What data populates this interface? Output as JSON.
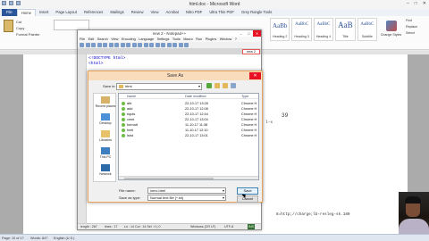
{
  "word": {
    "title": "html.doc - Microsoft Word",
    "window_controls": [
      "–",
      "□",
      "✕"
    ],
    "ribbon_tabs": [
      "File",
      "Home",
      "Insert",
      "Page Layout",
      "References",
      "Mailings",
      "Review",
      "View",
      "Acrobat",
      "Nitro PDF",
      "Ultra Thin PDF",
      "Grey Rangle Tools"
    ],
    "active_tab": "Home",
    "clipboard": {
      "cut": "Cut",
      "copy": "Copy",
      "format_painter": "Format Painter"
    },
    "styles": [
      {
        "preview": "AaBb",
        "name": "Heading 2"
      },
      {
        "preview": "AaBbC",
        "name": "Heading 3"
      },
      {
        "preview": "AaBbC",
        "name": "Heading 4"
      },
      {
        "preview": "AaB",
        "name": "Title"
      },
      {
        "preview": "AaBbC",
        "name": "Subtitle"
      }
    ],
    "change_styles": "Change Styles",
    "editing": [
      "Find",
      "Replace",
      "Select"
    ],
    "doc_fragments": [
      "39",
      "l-s",
      "8=http;//charge;lb-resleg-sk.180"
    ],
    "status": {
      "page": "Page: 10 of 17",
      "words": "Words: 847",
      "language": "English (U.S.)"
    }
  },
  "notepad": {
    "title": "new 2 - Notepad++",
    "menu": [
      "File",
      "Edit",
      "Search",
      "View",
      "Encoding",
      "Language",
      "Settings",
      "Tools",
      "Macro",
      "Run",
      "Plugins",
      "Window",
      "?"
    ],
    "tab": "new 2",
    "code": [
      "<!DOCTYPE html>",
      "<html>"
    ],
    "status": {
      "length": "length : 267",
      "lines": "lines : 17",
      "position": "Ln : 14  Col : 14  Sel : 0 | 0",
      "eol": "Windows (CR LF)",
      "encoding": "UTF-8",
      "mode": "INS"
    }
  },
  "dialog": {
    "title": "Save As",
    "close": "✕",
    "save_in_label": "Save in:",
    "save_in_value": "html",
    "places": [
      "Recent places",
      "Desktop",
      "Libraries",
      "This PC",
      "Network"
    ],
    "columns": [
      "Name",
      "Date modified",
      "Type"
    ],
    "files": [
      {
        "name": "abt",
        "date": "22-10-17 13:28",
        "type": "Chrome H"
      },
      {
        "name": "add",
        "date": "22-10-17 12:08",
        "type": "Chrome H"
      },
      {
        "name": "bquts",
        "date": "22-10-17 12:44",
        "type": "Chrome H"
      },
      {
        "name": "cmnt",
        "date": "22-10-17 13:04",
        "type": "Chrome H"
      },
      {
        "name": "formatt",
        "date": "11-10-17 11:38",
        "type": "Chrome H"
      },
      {
        "name": "hmtl",
        "date": "11-10-17 12:10",
        "type": "Chrome H"
      },
      {
        "name": "lsbd",
        "date": "22-10-17 13:01",
        "type": "Chrome H"
      }
    ],
    "file_name_label": "File name:",
    "file_name_value": "iomc.html",
    "save_type_label": "Save as type:",
    "save_type_value": "Normal text file (*.txt)",
    "save_button": "Save",
    "cancel_button": "Cancel"
  }
}
